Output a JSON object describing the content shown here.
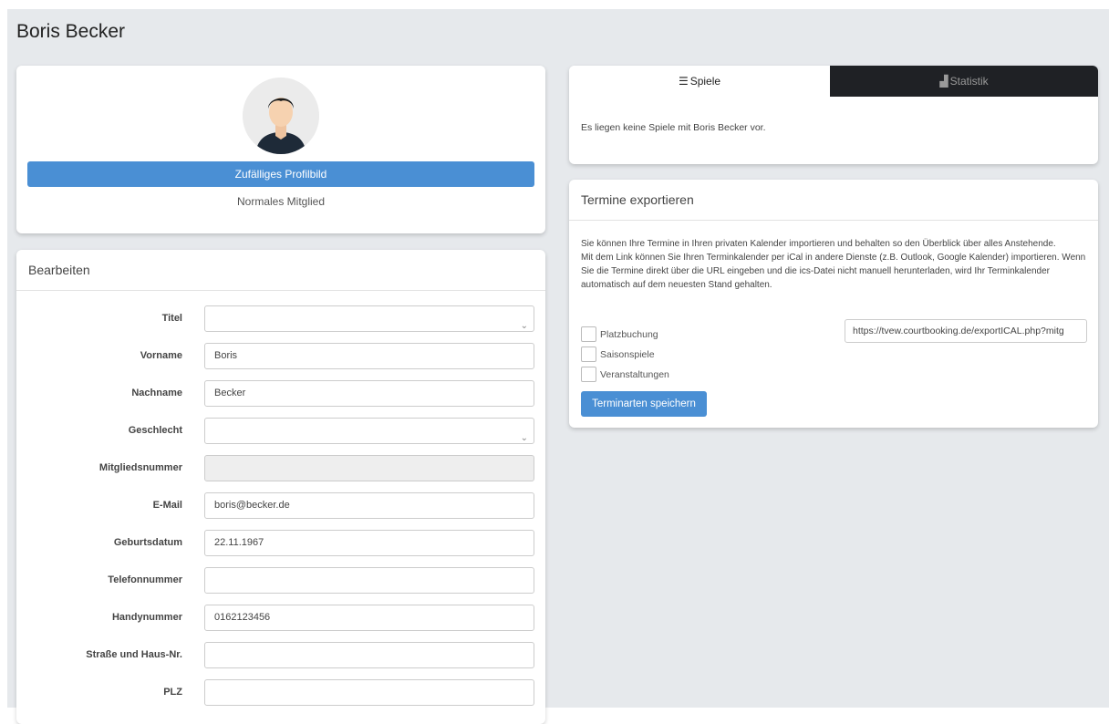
{
  "page": {
    "title": "Boris Becker"
  },
  "profile": {
    "random_picture_button": "Zufälliges Profilbild",
    "member_type": "Normales Mitglied"
  },
  "edit": {
    "header": "Bearbeiten",
    "fields": [
      {
        "label": "Titel",
        "value": "",
        "type": "select"
      },
      {
        "label": "Vorname",
        "value": "Boris",
        "type": "text"
      },
      {
        "label": "Nachname",
        "value": "Becker",
        "type": "text"
      },
      {
        "label": "Geschlecht",
        "value": "",
        "type": "select"
      },
      {
        "label": "Mitgliedsnummer",
        "value": "",
        "type": "disabled"
      },
      {
        "label": "E-Mail",
        "value": "boris@becker.de",
        "type": "text"
      },
      {
        "label": "Geburtsdatum",
        "value": "22.11.1967",
        "type": "text"
      },
      {
        "label": "Telefonnummer",
        "value": "",
        "type": "text"
      },
      {
        "label": "Handynummer",
        "value": "0162123456",
        "type": "text"
      },
      {
        "label": "Straße und Haus-Nr.",
        "value": "",
        "type": "text"
      },
      {
        "label": "PLZ",
        "value": "",
        "type": "text"
      }
    ]
  },
  "tabs": {
    "games_label": "Spiele",
    "stats_label": "Statistik",
    "no_games_text": "Es liegen keine Spiele mit Boris Becker vor."
  },
  "export": {
    "header": "Termine exportieren",
    "description_1": "Sie können Ihre Termine in Ihren privaten Kalender importieren und behalten so den Überblick über alles Anstehende.",
    "description_2": "Mit dem Link können Sie Ihren Terminkalender per iCal in andere Dienste (z.B. Outlook, Google Kalender) importieren. Wenn Sie die Termine direkt über die URL eingeben und die ics-Datei nicht manuell herunterladen, wird Ihr Terminkalender automatisch auf dem neuesten Stand gehalten.",
    "options": [
      {
        "label": "Platzbuchung",
        "checked": false
      },
      {
        "label": "Saisonspiele",
        "checked": false
      },
      {
        "label": "Veranstaltungen",
        "checked": false
      }
    ],
    "url_value": "https://tvew.courtbooking.de/exportICAL.php?mitg",
    "save_button": "Terminarten speichern"
  },
  "colors": {
    "accent": "#4a8fd4",
    "tab_dark": "#1f2125",
    "page_bg": "#e6e9ec"
  },
  "icons": {
    "games_tab": "list-icon",
    "stats_tab": "bar-chart-icon",
    "select_arrow": "chevron-down-icon"
  }
}
